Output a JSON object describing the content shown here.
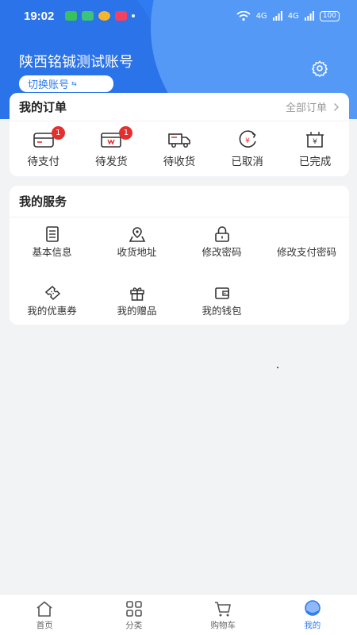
{
  "status_bar": {
    "time": "19:02",
    "signal_labels": [
      "4G",
      "4G"
    ],
    "battery": "100"
  },
  "account": {
    "name": "陕西铭铖测试账号",
    "switch_label": "切换账号",
    "switch_icon": "swap-icon"
  },
  "orders": {
    "title": "我的订单",
    "more_label": "全部订单",
    "items": [
      {
        "label": "待支付",
        "icon": "wallet-card-icon",
        "badge": "1"
      },
      {
        "label": "待发货",
        "icon": "package-box-icon",
        "badge": "1"
      },
      {
        "label": "待收货",
        "icon": "delivery-truck-icon",
        "badge": ""
      },
      {
        "label": "已取消",
        "icon": "refund-yen-icon",
        "badge": ""
      },
      {
        "label": "已完成",
        "icon": "receipt-yen-icon",
        "badge": ""
      }
    ]
  },
  "services": {
    "title": "我的服务",
    "items": [
      {
        "label": "基本信息",
        "icon": "document-icon"
      },
      {
        "label": "收货地址",
        "icon": "location-map-icon"
      },
      {
        "label": "修改密码",
        "icon": "lock-icon"
      },
      {
        "label": "修改支付密码",
        "icon": "pay-password-icon"
      },
      {
        "label": "我的优惠券",
        "icon": "coupon-icon"
      },
      {
        "label": "我的赠品",
        "icon": "gift-icon"
      },
      {
        "label": "我的钱包",
        "icon": "wallet-icon"
      }
    ]
  },
  "tabbar": {
    "items": [
      {
        "label": "首页",
        "icon": "home-icon",
        "active": false
      },
      {
        "label": "分类",
        "icon": "category-grid-icon",
        "active": false
      },
      {
        "label": "购物车",
        "icon": "cart-icon",
        "active": false
      },
      {
        "label": "我的",
        "icon": "profile-icon",
        "active": true
      }
    ]
  },
  "colors": {
    "primary": "#2f7bf2",
    "badge": "#e3302f",
    "background": "#f2f3f5"
  }
}
